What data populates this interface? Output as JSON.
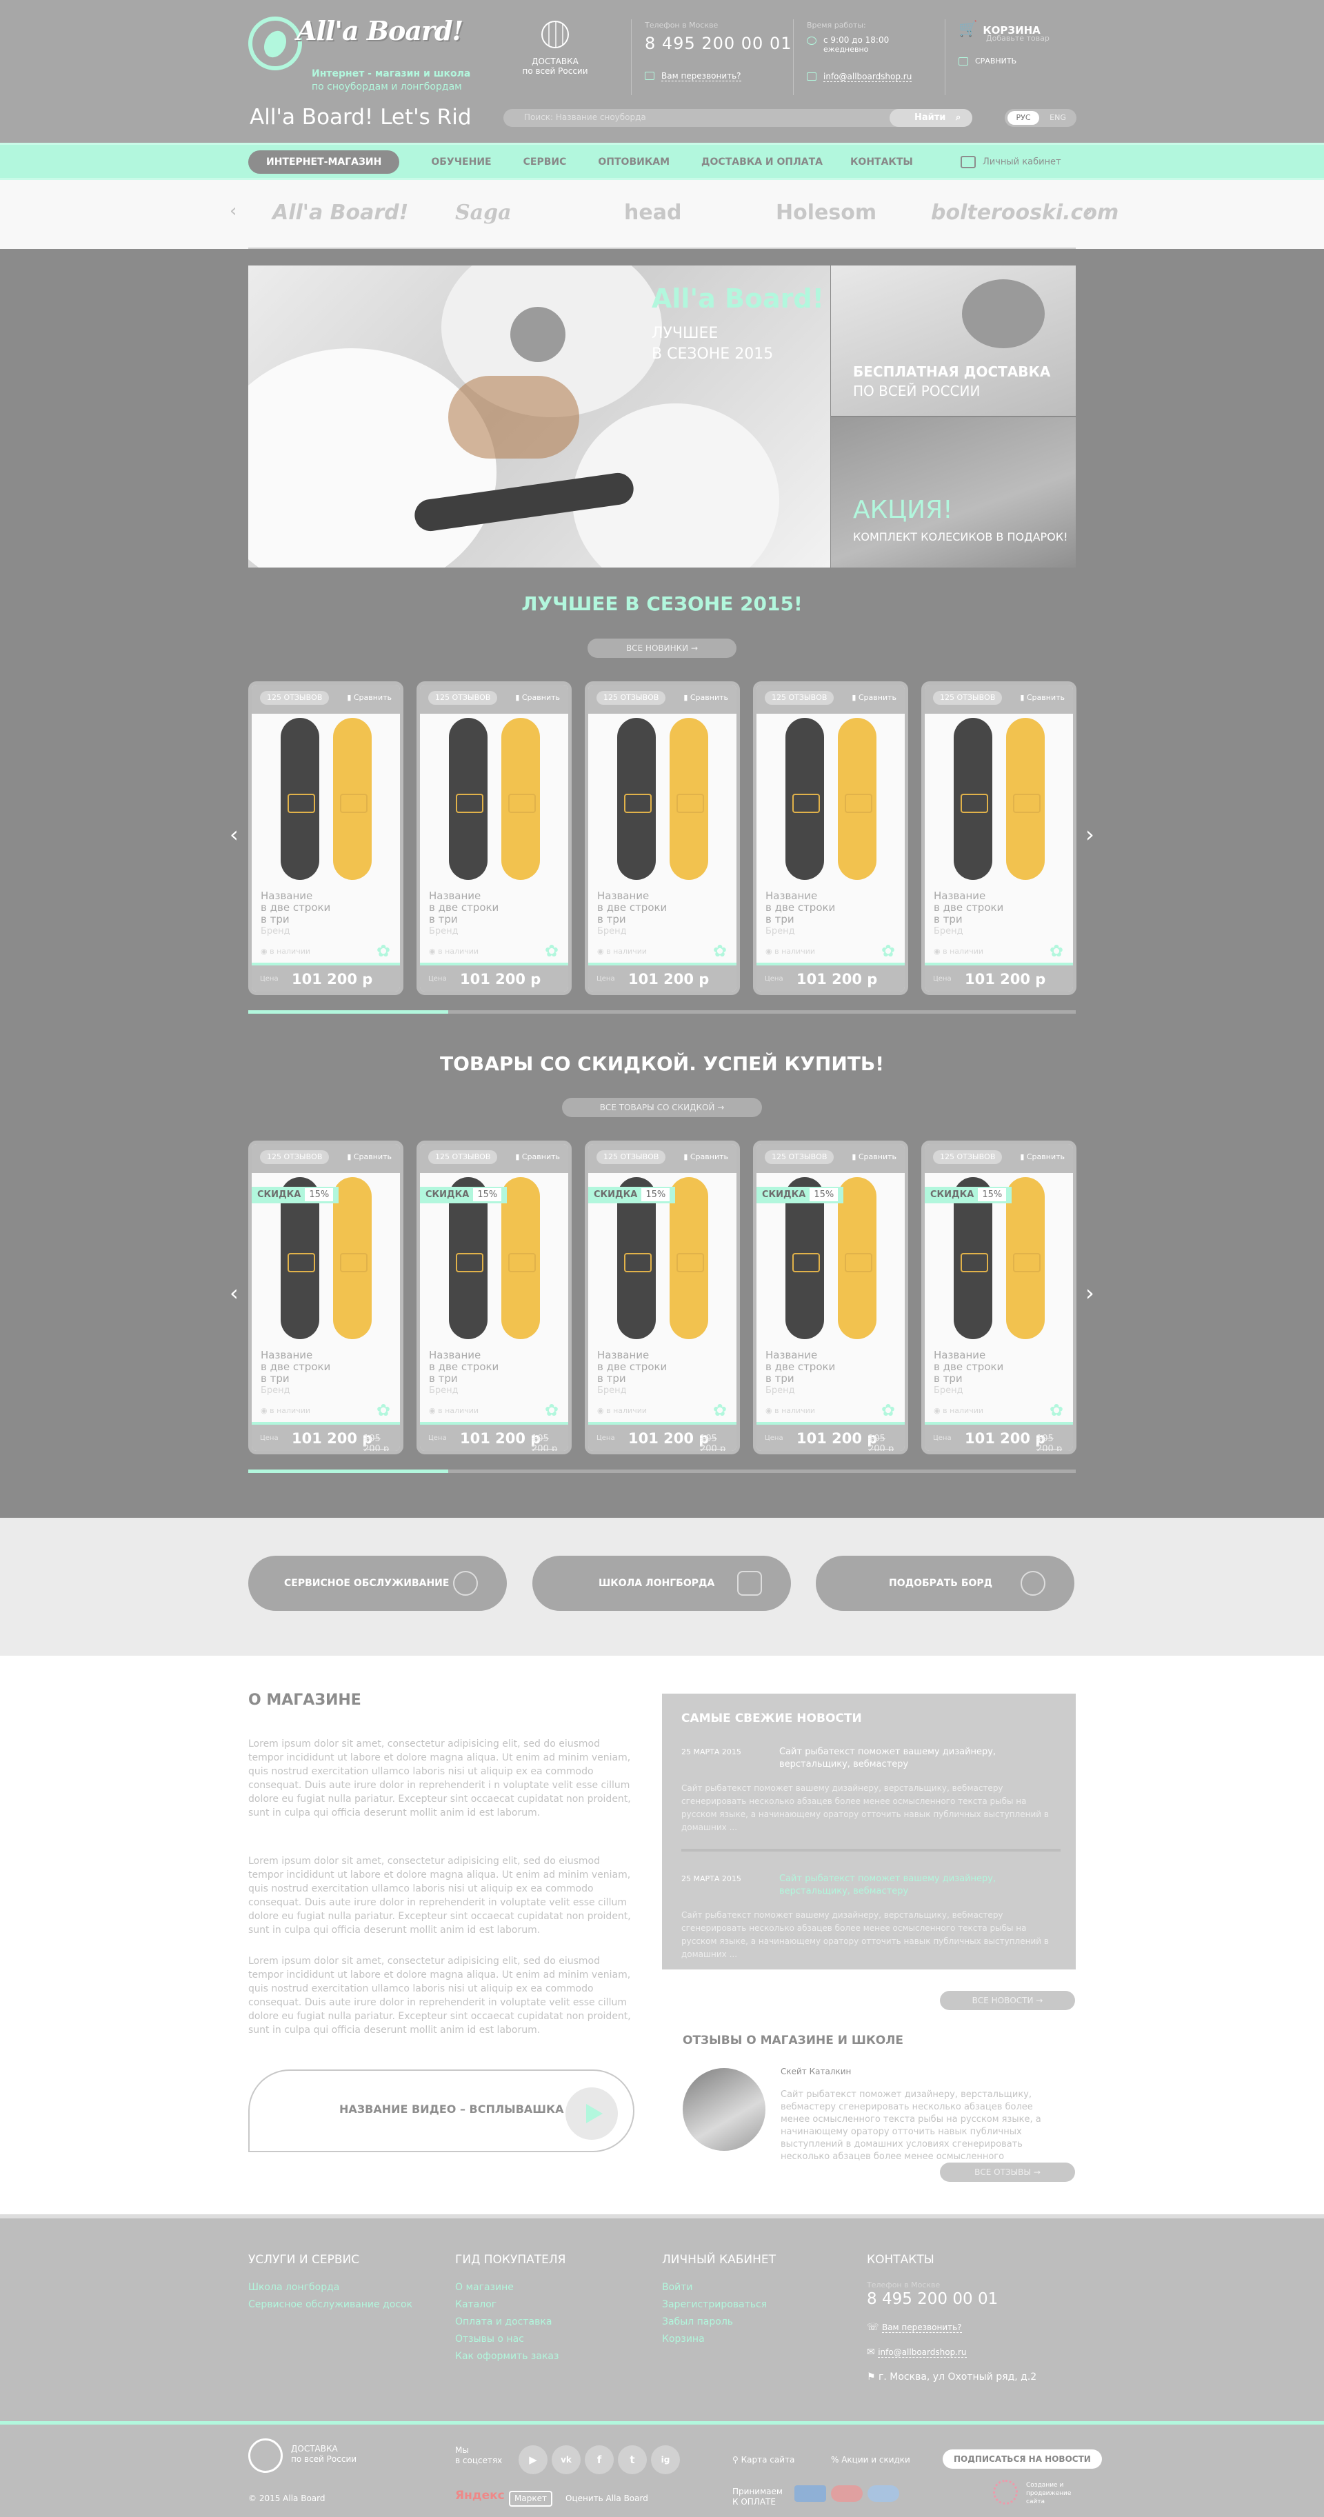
{
  "header": {
    "logo": "All'a Board!",
    "tagline_bold": "Интернет - магазин и школа",
    "tagline": "по сноубордам и лонгбордам",
    "delivery_line1": "ДОСТАВКА",
    "delivery_line2": "по всей России",
    "phone_caption": "Телефон в Москве",
    "phone": "8 495 200 00 01",
    "callback": "Вам перезвонить?",
    "hours_caption": "Время работы:",
    "hours": "с 9:00 до 18:00",
    "hours_days": "ежедневно",
    "email": "info@allboardshop.ru",
    "cart_title": "КОРЗИНА",
    "cart_status": "Добавьте товар",
    "compare": "СРАВНИТЬ",
    "site_title": "All'a Board! Let's Rid",
    "search_placeholder": "Поиск: Название сноуборда",
    "search_button": "Найти",
    "lang": [
      "РУС",
      "ENG"
    ]
  },
  "nav": {
    "items": [
      "ИНТЕРНЕТ-МАГАЗИН",
      "ОБУЧЕНИЕ",
      "СЕРВИС",
      "ОПТОВИКАМ",
      "ДОСТАВКА И ОПЛАТА",
      "КОНТАКТЫ"
    ],
    "account": "Личный кабинет"
  },
  "brands": [
    "All'a Board!",
    "Saga",
    "head",
    "Holesom",
    "bolterooski.com"
  ],
  "hero": {
    "title": "All'a Board!",
    "subtitle": "ЛУЧШЕЕ\nВ СЕЗОНЕ 2015",
    "promo1": "БЕСПЛАТНАЯ ДОСТАВКА",
    "promo1_sub": "ПО ВСЕЙ РОССИИ",
    "promo2_title": "АКЦИЯ!",
    "promo2_sub": "КОМПЛЕКТ КОЛЕСИКОВ В ПОДАРОК!"
  },
  "best": {
    "title": "ЛУЧШЕЕ В СЕЗОНЕ 2015!",
    "button": "ВСЕ НОВИНКИ"
  },
  "discount": {
    "title": "ТОВАРЫ СО СКИДКОЙ. УСПЕЙ КУПИТЬ!",
    "button": "ВСЕ ТОВАРЫ СО СКИДКОЙ"
  },
  "product": {
    "reviews": "125 ОТЗЫВОВ",
    "compare": "Сравнить",
    "name": "Название\nв две строки\nв три",
    "brand": "Бренд",
    "stock": "в наличии",
    "price_label": "Цена",
    "price": "101 200 р",
    "old_price": "105 200 р",
    "sale_label": "СКИДКА",
    "sale_value": "15%"
  },
  "services": [
    "СЕРВИСНОЕ ОБСЛУЖИВАНИЕ",
    "ШКОЛА ЛОНГБОРДА",
    "ПОДОБРАТЬ БОРД"
  ],
  "about": {
    "title": "О МАГАЗИНЕ",
    "p1": "Lorem ipsum dolor sit amet, consectetur adipisicing elit, sed do eiusmod tempor incididunt ut labore et dolore magna aliqua. Ut enim ad minim veniam, quis nostrud exercitation ullamco laboris nisi ut aliquip ex ea commodo consequat. Duis aute irure dolor in reprehenderit i n voluptate velit esse cillum dolore eu fugiat nulla pariatur. Excepteur sint occaecat cupidatat non proident, sunt in culpa qui officia deserunt mollit anim id est laborum.",
    "p2": "Lorem ipsum dolor sit amet, consectetur adipisicing elit, sed do eiusmod tempor incididunt ut labore et dolore magna aliqua. Ut enim ad minim veniam, quis nostrud exercitation ullamco laboris nisi ut aliquip ex ea commodo consequat. Duis aute irure dolor in reprehenderit in voluptate velit esse cillum dolore eu fugiat nulla pariatur. Excepteur sint occaecat cupidatat non proident, sunt in culpa qui officia deserunt mollit anim id est laborum.",
    "p3": "Lorem ipsum dolor sit amet, consectetur adipisicing elit, sed do eiusmod tempor incididunt ut labore et dolore magna aliqua. Ut enim ad minim veniam, quis nostrud exercitation ullamco laboris nisi ut aliquip ex ea commodo consequat. Duis aute irure dolor in reprehenderit in voluptate velit esse cillum dolore eu fugiat nulla pariatur. Excepteur sint occaecat cupidatat non proident, sunt in culpa qui officia deserunt mollit anim id est laborum.",
    "video": "НАЗВАНИЕ ВИДЕО – ВСПЛЫВАШКА"
  },
  "news": {
    "title": "САМЫЕ СВЕЖИЕ НОВОСТИ",
    "items": [
      {
        "date": "25 МАРТА 2015",
        "head": "Сайт рыбатекст поможет вашему дизайнеру, верстальщику, вебмастеру",
        "body": "Сайт рыбатекст поможет вашему дизайнеру, верстальщику, вебмастеру сгенерировать несколько абзацев более менее осмысленного текста рыбы на русском языке, а начинающему оратору отточить навык публичных выступлений в домашних ..."
      },
      {
        "date": "25 МАРТА 2015",
        "head": "Сайт рыбатекст поможет вашему дизайнеру, верстальщику, вебмастеру",
        "body": "Сайт рыбатекст поможет вашему дизайнеру, верстальщику, вебмастеру сгенерировать несколько абзацев более менее осмысленного текста рыбы на русском языке, а начинающему оратору отточить навык публичных выступлений в домашних ..."
      }
    ],
    "button": "ВСЕ НОВОСТИ"
  },
  "reviews": {
    "title": "ОТЗЫВЫ О МАГАЗИНЕ И ШКОЛЕ",
    "name": "Скейт Каталкин",
    "text": "Сайт рыбатекст поможет дизайнеру, верстальщику, вебмастеру сгенерировать несколько абзацев более менее осмысленного текста рыбы на русском языке, а начинающему оратору отточить навык публичных выступлений в домашних условиях сгенерировать несколько абзацев более менее осмысленного",
    "button": "ВСЕ ОТЗЫВЫ"
  },
  "footer": {
    "col1_title": "УСЛУГИ И СЕРВИС",
    "col1": [
      "Школа лонгборда",
      "Сервисное обслуживание досок"
    ],
    "col2_title": "ГИД ПОКУПАТЕЛЯ",
    "col2": [
      "О магазине",
      "Каталог",
      "Оплата и доставка",
      "Отзывы о нас",
      "Как оформить заказ"
    ],
    "col3_title": "ЛИЧНЫЙ КАБИНЕТ",
    "col3": [
      "Войти",
      "Зарегистрироваться",
      "Забыл пароль",
      "Корзина"
    ],
    "col4_title": "КОНТАКТЫ",
    "phone_caption": "Телефон в Москве",
    "phone": "8 495 200 00 01",
    "callback": "Вам перезвонить?",
    "email": "info@allboardshop.ru",
    "address": "г. Москва, ул Охотный ряд, д.2",
    "delivery1": "ДОСТАВКА",
    "delivery2": "по всей России",
    "social_label": "Мы\nв соцсетях",
    "social": [
      "▶",
      "vk",
      "f",
      "t",
      "ig"
    ],
    "sitemap": "Карта сайта",
    "promo": "Акции и скидки",
    "subscribe": "ПОДПИСАТЬСЯ НА НОВОСТИ",
    "copyright": "© 2015 Alla Board",
    "yandex": "Яндекс",
    "market": "Маркет",
    "rate": "Оценить Alla Board",
    "pay_label": "Принимаем\nК ОПЛАТЕ",
    "dev": "Создание и продвижение сайта"
  }
}
